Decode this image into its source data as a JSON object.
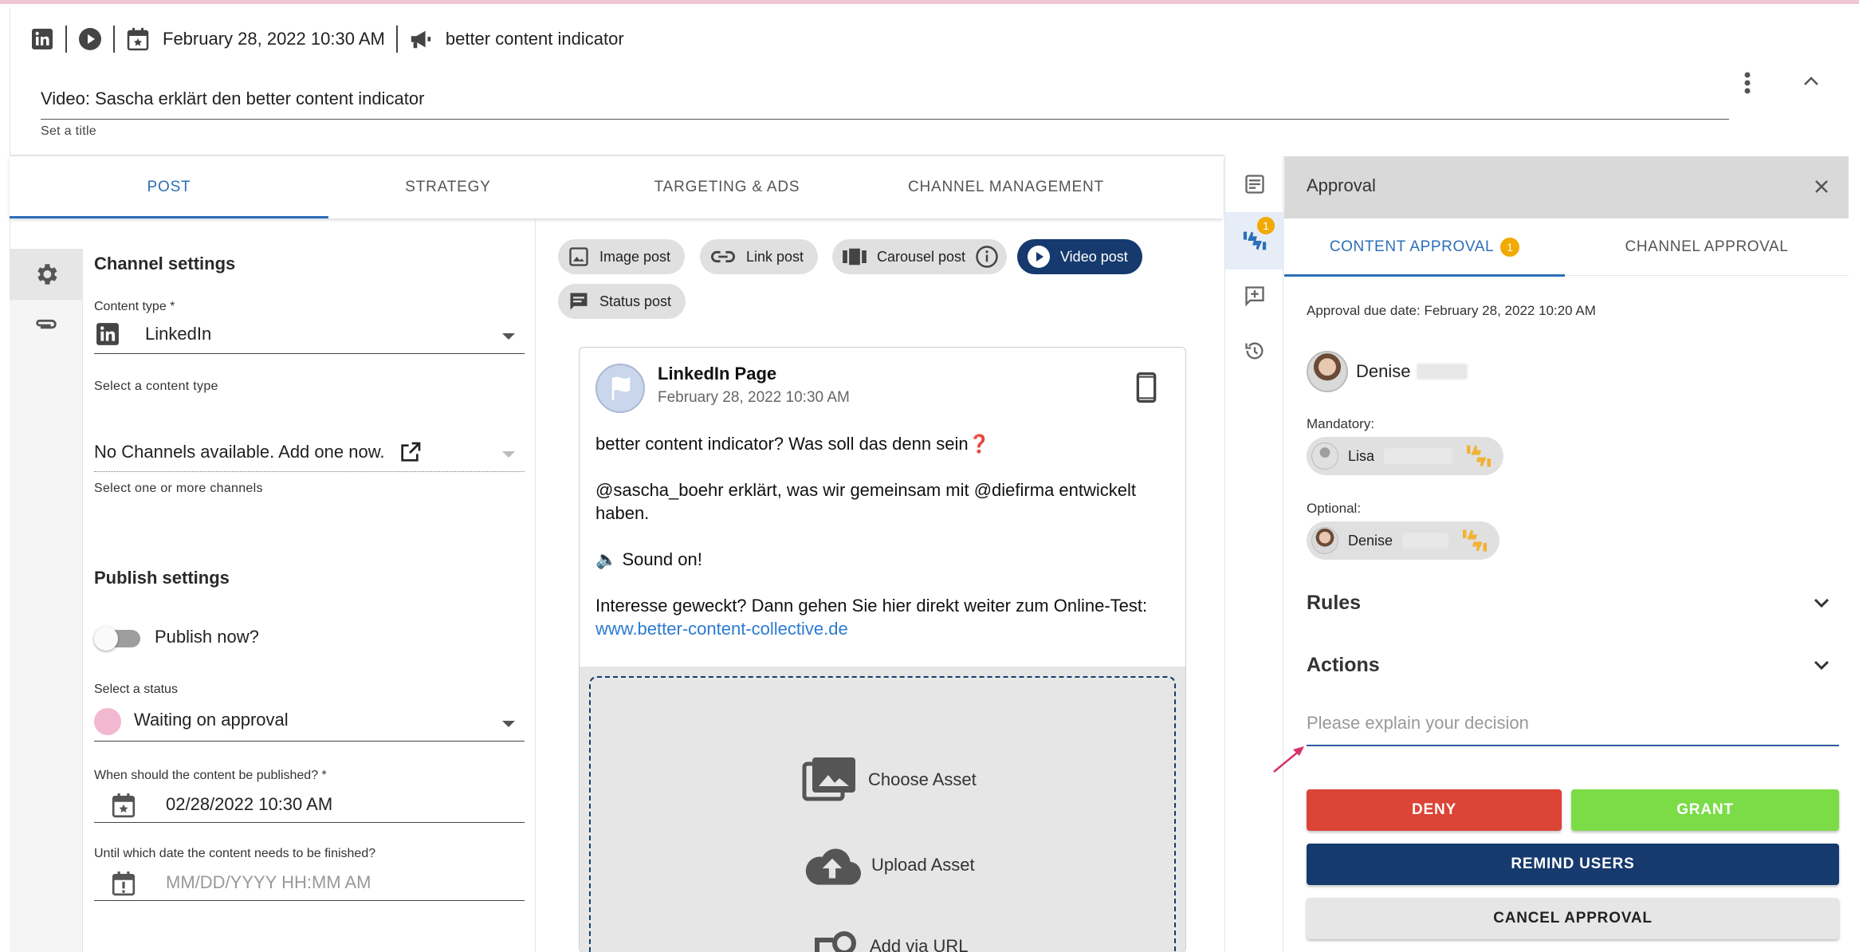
{
  "header": {
    "date": "February 28, 2022 10:30 AM",
    "campaign": "better content indicator",
    "title_value": "Video: Sascha erklärt den better content indicator",
    "title_help": "Set a title"
  },
  "tabs": [
    {
      "label": "POST"
    },
    {
      "label": "STRATEGY"
    },
    {
      "label": "TARGETING & ADS"
    },
    {
      "label": "CHANNEL MANAGEMENT"
    }
  ],
  "channel_settings": {
    "heading": "Channel settings",
    "content_type_label": "Content type *",
    "content_type_value": "LinkedIn",
    "content_type_help": "Select a content type",
    "channels_value": "No Channels available. Add one now.",
    "channels_help": "Select one or more channels"
  },
  "publish_settings": {
    "heading": "Publish settings",
    "publish_now_label": "Publish now?",
    "status_label": "Select a status",
    "status_value": "Waiting on approval",
    "status_color": "#f2b8cf",
    "publish_date_label": "When should the content be published? *",
    "publish_date_value": "02/28/2022 10:30 AM",
    "finish_date_label": "Until which date the content needs to be finished?",
    "finish_date_placeholder": "MM/DD/YYYY HH:MM AM"
  },
  "post_types": [
    {
      "label": "Image post"
    },
    {
      "label": "Link post"
    },
    {
      "label": "Carousel post"
    },
    {
      "label": "Video post"
    },
    {
      "label": "Status post"
    }
  ],
  "preview": {
    "page_name": "LinkedIn Page",
    "date": "February 28, 2022 10:30 AM",
    "line1": "better content indicator? Was soll das denn sein",
    "line1_mark": "❓",
    "line2": "@sascha_boehr erklärt, was wir gemeinsam mit @diefirma entwickelt haben.",
    "line3": "🔈 Sound on!",
    "line4": "Interesse geweckt? Dann gehen Sie hier direkt weiter zum Online-Test:",
    "link": "www.better-content-collective.de",
    "choose_asset": "Choose Asset",
    "upload_asset": "Upload Asset",
    "add_via_url": "Add via URL"
  },
  "right_rail": {
    "approval_badge": "1"
  },
  "approval": {
    "title": "Approval",
    "tab_content": "CONTENT APPROVAL",
    "tab_content_badge": "1",
    "tab_channel": "CHANNEL APPROVAL",
    "due_date": "Approval due date: February 28, 2022 10:20 AM",
    "owner_name": "Denise",
    "mandatory_label": "Mandatory:",
    "mandatory_user": "Lisa",
    "optional_label": "Optional:",
    "optional_user": "Denise",
    "rules_label": "Rules",
    "actions_label": "Actions",
    "decision_placeholder": "Please explain your decision",
    "deny_label": "DENY",
    "grant_label": "GRANT",
    "remind_label": "REMIND USERS",
    "cancel_label": "CANCEL APPROVAL"
  },
  "colors": {
    "accent": "#2c6fb7",
    "navy": "#163a6e",
    "deny": "#db4437",
    "grant": "#7bdc48",
    "badge": "#f2a900",
    "link": "#2b7bd2"
  }
}
